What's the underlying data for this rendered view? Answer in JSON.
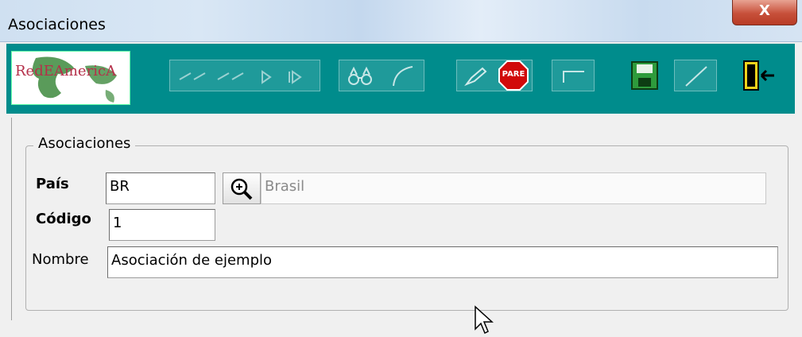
{
  "window": {
    "title": "Asociaciones",
    "close_label": "X"
  },
  "toolbar": {
    "logo_text": "RedEAmericA",
    "stop_label": "PARE",
    "accent_color": "#008c8c",
    "icons": [
      "first-icon",
      "prev-icon",
      "next-icon",
      "last-icon",
      "binoculars-icon",
      "refresh-icon",
      "edit-icon",
      "stop-icon",
      "new-icon",
      "save-icon",
      "cancel-icon",
      "exit-door-icon"
    ]
  },
  "form": {
    "group_title": "Asociaciones",
    "pais": {
      "label": "País",
      "value": "BR",
      "name_value": "Brasil"
    },
    "codigo": {
      "label": "Código",
      "value": "1"
    },
    "nombre": {
      "label": "Nombre",
      "value": "Asociación de ejemplo"
    }
  }
}
